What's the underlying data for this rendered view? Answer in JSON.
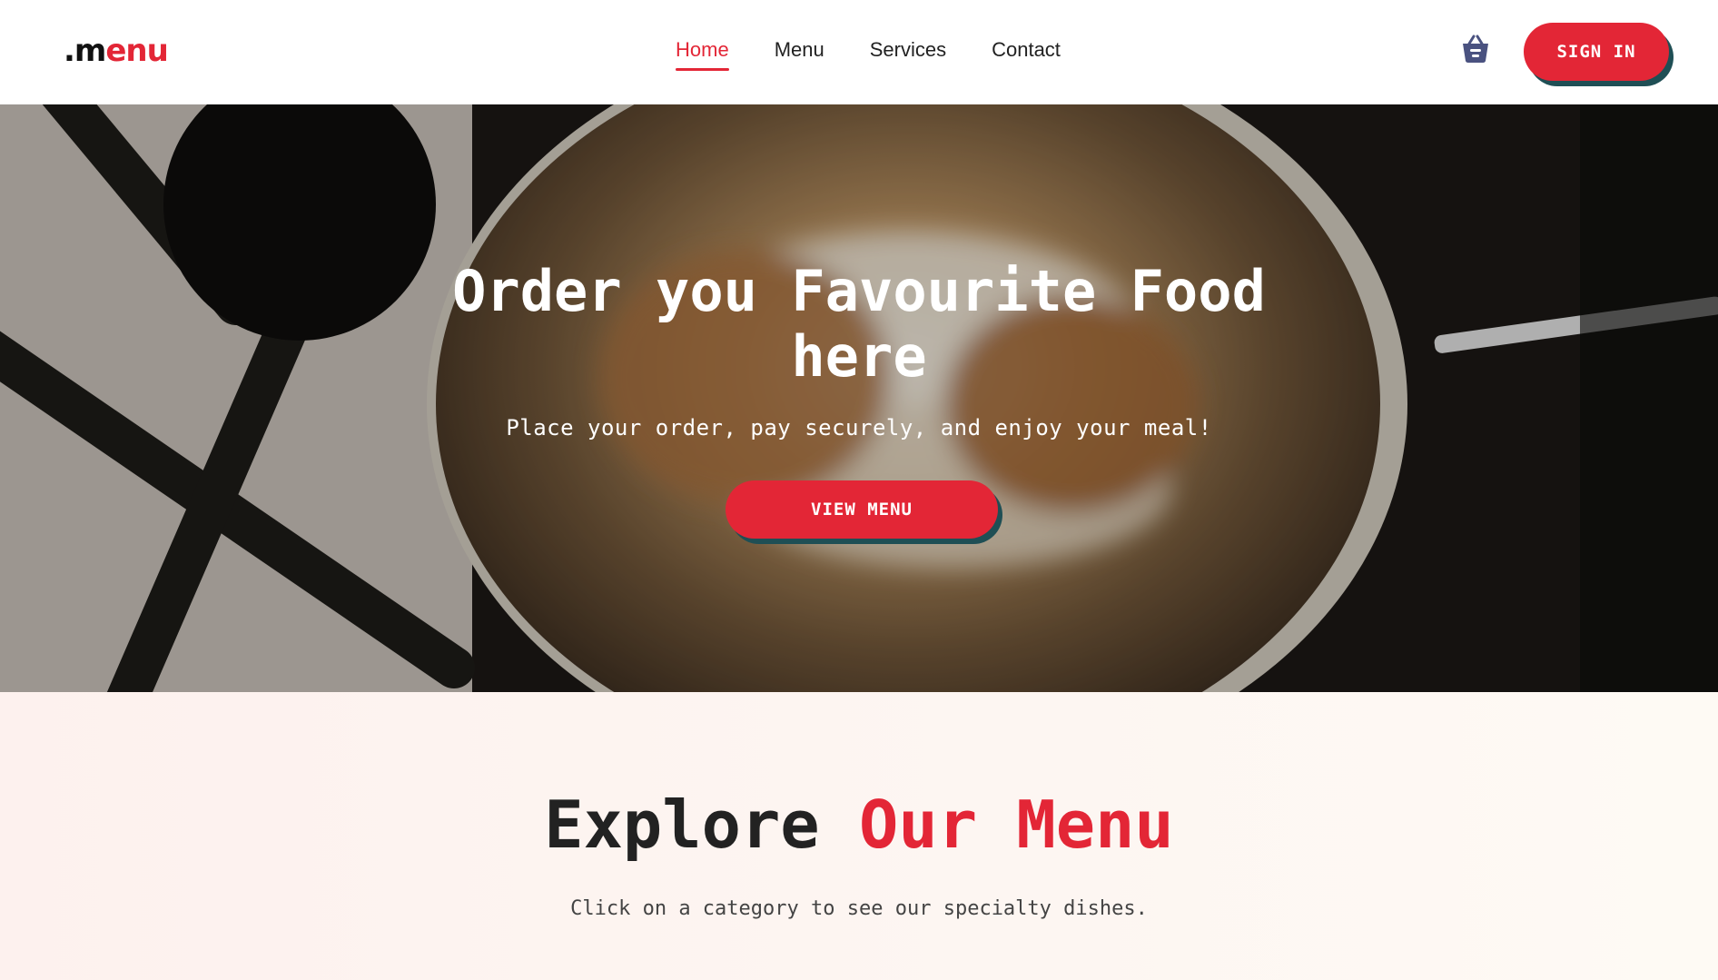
{
  "header": {
    "logo": {
      "dot": ".",
      "m": "m",
      "rest": "enu"
    },
    "nav": [
      {
        "label": "Home",
        "active": true
      },
      {
        "label": "Menu",
        "active": false
      },
      {
        "label": "Services",
        "active": false
      },
      {
        "label": "Contact",
        "active": false
      }
    ],
    "cart_icon": "basket-icon",
    "signin_label": "SIGN IN"
  },
  "hero": {
    "title_line1": "Order you Favourite Food",
    "title_line2": "here",
    "subtitle": "Place your order, pay securely, and enjoy your meal!",
    "button_label": "VIEW MENU"
  },
  "explore": {
    "title_main": "Explore ",
    "title_accent": "Our Menu",
    "subtitle": "Click on a category to see our specialty dishes."
  },
  "colors": {
    "accent": "#e32636",
    "button_shadow": "#1f4f55",
    "cart_icon": "#4a5280"
  }
}
